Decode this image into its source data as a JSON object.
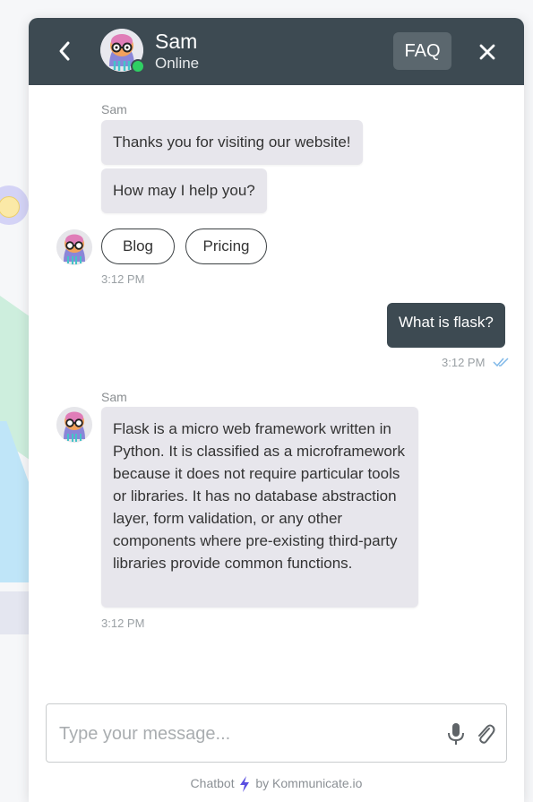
{
  "header": {
    "agent_name": "Sam",
    "status": "Online",
    "faq_label": "FAQ",
    "icons": {
      "back": "chevron-left-icon",
      "close": "close-icon"
    }
  },
  "messages": [
    {
      "sender": "Sam",
      "text": "Thanks you for visiting our website!"
    },
    {
      "text": "How may I help you?"
    },
    {
      "quick_replies": [
        "Blog",
        "Pricing"
      ],
      "time": "3:12 PM"
    },
    {
      "sender": "user",
      "text": "What is flask?",
      "time": "3:12 PM",
      "read_receipt": "double-check-icon"
    },
    {
      "sender": "Sam",
      "text": "Flask is a micro web framework written in Python. It is classified as a microframework because it does not require particular tools or libraries. It has no database abstraction layer, form validation, or any other components where pre-existing third-party libraries provide common functions.",
      "time": "3:12 PM"
    }
  ],
  "composer": {
    "placeholder": "Type your message...",
    "icons": {
      "mic": "microphone-icon",
      "attach": "paperclip-icon"
    }
  },
  "footer": {
    "prefix": "Chatbot",
    "suffix": "by Kommunicate.io",
    "icon": "lightning-icon"
  },
  "colors": {
    "header_bg": "#3d4a52",
    "incoming_bubble": "#e7e6ec",
    "outgoing_bubble": "#3d4a52",
    "online": "#2fcf63",
    "read_receipt": "#7fb8e8",
    "bolt": "#5b4fe0"
  }
}
